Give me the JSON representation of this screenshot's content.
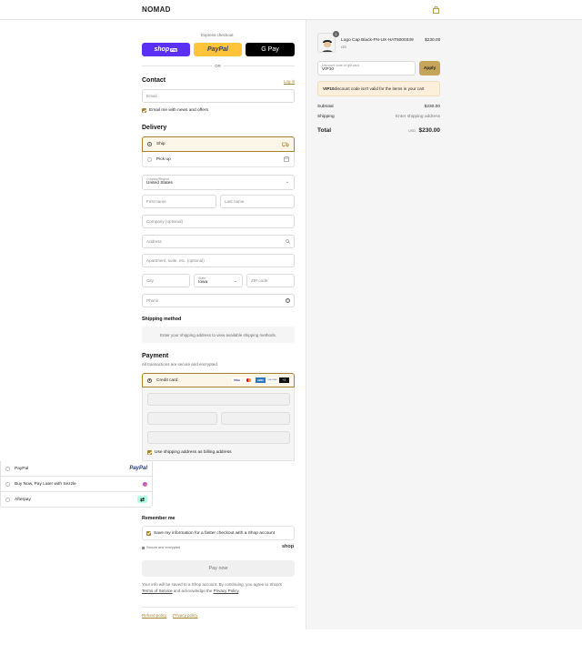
{
  "header": {
    "brand": "NOMAD"
  },
  "express": {
    "label": "Express checkout",
    "shop_pay": "shop",
    "shop_pay_badge": "Pay",
    "paypal": "PayPal",
    "gpay": "G Pay",
    "or": "OR"
  },
  "contact": {
    "title": "Contact",
    "login": "Log in",
    "email_placeholder": "Email",
    "news_label": "Email me with news and offers"
  },
  "delivery": {
    "title": "Delivery",
    "ship": "Ship",
    "pickup": "Pick up",
    "country_label": "Country/Region",
    "country_value": "United States",
    "first_name": "First name",
    "last_name": "Last name",
    "company": "Company (optional)",
    "address": "Address",
    "apartment": "Apartment, suite, etc. (optional)",
    "city": "City",
    "state_label": "State",
    "state_value": "Iowa",
    "zip": "ZIP code",
    "phone": "Phone"
  },
  "shipping_method": {
    "title": "Shipping method",
    "message": "Enter your shipping address to view available shipping methods."
  },
  "payment": {
    "title": "Payment",
    "subtitle": "All transactions are secure and encrypted.",
    "credit_card": "Credit card",
    "cards": [
      "VISA",
      "MC",
      "AMEX",
      "DISCOVER"
    ],
    "more": "+2",
    "billing_label": "Use shipping address as billing address",
    "paypal": "PayPal",
    "sezzle": "Buy Now, Pay Later with Sezzle",
    "afterpay": "Afterpay"
  },
  "remember": {
    "title": "Remember me",
    "save_label": "Save my information for a faster checkout with a Shop account",
    "secure": "Secure and encrypted",
    "shop": "shop"
  },
  "pay": {
    "label": "Pay now",
    "legal_1": "Your info will be saved to a Shop account. By continuing, you agree to Shop's",
    "terms": "Terms of Service",
    "legal_2": "and acknowledge the",
    "privacy": "Privacy Policy",
    "period": "."
  },
  "footer": {
    "refund": "Refund policy",
    "privacy": "Privacy policy"
  },
  "cart": {
    "qty": "1",
    "product": "Logo Cap Black-FN-UX-HAT5000339",
    "variant": "OS",
    "price": "$230.00",
    "discount_label": "Discount code or gift card",
    "discount_value": "VIP10",
    "apply": "Apply",
    "error_code": "VIP10",
    "error_text": " discount code isn't valid for the items in your cart",
    "subtotal_label": "Subtotal",
    "subtotal": "$230.00",
    "shipping_label": "Shipping",
    "shipping": "Enter shipping address",
    "total_label": "Total",
    "currency": "USD",
    "total": "$230.00"
  },
  "colors": {
    "accent": "#a5842d",
    "shop_pay": "#5a31f4",
    "paypal_yellow": "#ffc439"
  }
}
